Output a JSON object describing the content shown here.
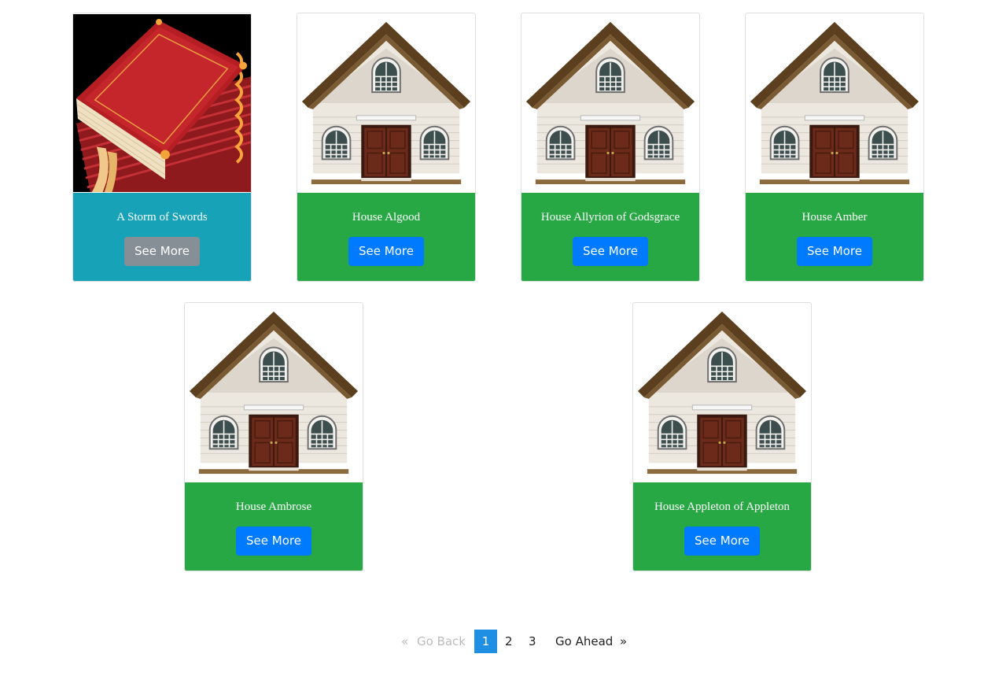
{
  "cards": [
    {
      "title": "A Storm of Swords",
      "button": "See More",
      "image": "book-stack-image",
      "theme": "teal"
    },
    {
      "title": "House Algood",
      "button": "See More",
      "image": "house-image",
      "theme": "green"
    },
    {
      "title": "House Allyrion of Godsgrace",
      "button": "See More",
      "image": "house-image",
      "theme": "green"
    },
    {
      "title": "House Amber",
      "button": "See More",
      "image": "house-image",
      "theme": "green"
    },
    {
      "title": "House Ambrose",
      "button": "See More",
      "image": "house-image",
      "theme": "green"
    },
    {
      "title": "House Appleton of Appleton",
      "button": "See More",
      "image": "house-image",
      "theme": "green"
    }
  ],
  "pagination": {
    "prev_arrow": "«",
    "prev_label": "Go Back",
    "pages": [
      "1",
      "2",
      "3"
    ],
    "current_page": "1",
    "next_label": "Go Ahead",
    "next_arrow": "»"
  },
  "colors": {
    "green_card": "#28a745",
    "teal_card": "#17a2b8",
    "primary_button": "#007bff",
    "secondary_button": "#868e96",
    "active_page": "#1e8fe3"
  }
}
